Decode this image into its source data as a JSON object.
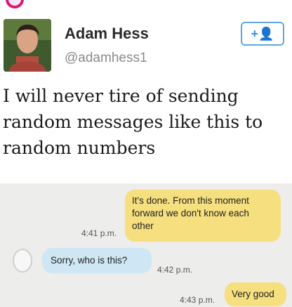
{
  "tweet": {
    "author_name": "Adam Hess",
    "author_handle": "@adamhess1",
    "follow_label": "+👤",
    "text_lines": [
      "I will never tire of sending",
      "random messages like this to",
      "random numbers"
    ]
  },
  "conversation": {
    "messages": [
      {
        "direction": "outgoing",
        "lines": [
          "It's done. From this moment",
          "forward we don't know each",
          "other"
        ],
        "time": "4:41 p.m."
      },
      {
        "direction": "incoming",
        "lines": [
          "Sorry, who is this?"
        ],
        "time": "4:42 p.m."
      },
      {
        "direction": "outgoing",
        "lines": [
          "Very good"
        ],
        "time": "4:43 p.m."
      }
    ]
  },
  "colors": {
    "outgoing_bubble": "#f6df7e",
    "incoming_bubble": "#cfe6f5",
    "follow_accent": "#3c8fd0"
  }
}
